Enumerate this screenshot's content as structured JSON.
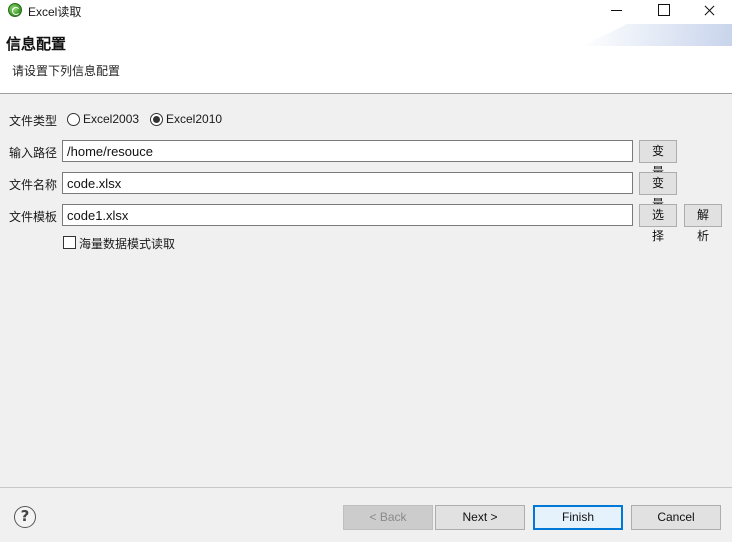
{
  "window": {
    "title": "Excel读取"
  },
  "header": {
    "title": "信息配置",
    "description": "请设置下列信息配置"
  },
  "form": {
    "file_type": {
      "label": "文件类型",
      "options": [
        {
          "label": "Excel2003",
          "selected": false
        },
        {
          "label": "Excel2010",
          "selected": true
        }
      ]
    },
    "input_path": {
      "label": "输入路径",
      "value": "/home/resouce",
      "button": "变 量"
    },
    "file_name": {
      "label": "文件名称",
      "value": "code.xlsx",
      "button": "变 量"
    },
    "file_template": {
      "label": "文件模板",
      "value": "code1.xlsx",
      "select_button": "选 择",
      "parse_button": "解 析"
    },
    "massive_data": {
      "label": "海量数据模式读取",
      "checked": false
    }
  },
  "footer": {
    "help_icon": "?",
    "back": "< Back",
    "next": "Next >",
    "finish": "Finish",
    "cancel": "Cancel"
  },
  "colors": {
    "accent": "#0078d7"
  }
}
